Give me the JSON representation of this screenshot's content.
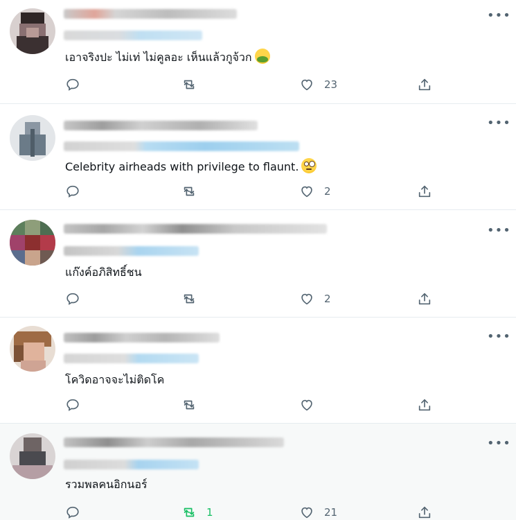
{
  "tweets": [
    {
      "text": "เอาจริงปะ ไม่เท่ ไม่คูลอะ เห็นแล้วกูจ้วก",
      "emoji": "nauseated-face",
      "reply_count": "",
      "retweet_count": "",
      "like_count": "23",
      "retweet_active": false
    },
    {
      "text": "Celebrity airheads with privilege to flaunt.",
      "emoji": "eye-roll-face",
      "reply_count": "",
      "retweet_count": "",
      "like_count": "2",
      "retweet_active": false
    },
    {
      "text": "แก๊งค์อภิสิทธิ์ชน",
      "emoji": "",
      "reply_count": "",
      "retweet_count": "",
      "like_count": "2",
      "retweet_active": false
    },
    {
      "text": "โควิดอาจจะไม่ติดโค",
      "emoji": "",
      "reply_count": "",
      "retweet_count": "",
      "like_count": "",
      "retweet_active": false
    },
    {
      "text": "รวมพลคนอิกนอร์",
      "emoji": "",
      "reply_count": "",
      "retweet_count": "1",
      "like_count": "21",
      "retweet_active": true
    }
  ],
  "icons": {
    "more": "more-horizontal-icon",
    "reply": "reply-icon",
    "retweet": "retweet-icon",
    "like": "heart-icon",
    "share": "share-icon"
  },
  "colors": {
    "text": "#0f1419",
    "muted": "#536471",
    "divider": "#e6ecf0",
    "retweet_active": "#17bf63",
    "highlight_bg": "#f7f9f9"
  }
}
